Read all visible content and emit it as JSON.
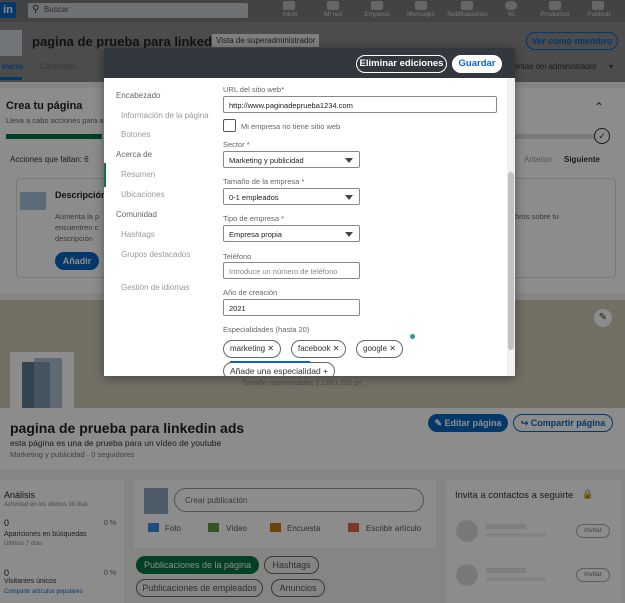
{
  "nav": {
    "logo": "in",
    "search_placeholder": "Buscar",
    "items": [
      "Inicio",
      "Mi red",
      "Empleos",
      "Mensajes",
      "Notificaciones",
      "Yo",
      "Productos",
      "Publicar"
    ]
  },
  "page": {
    "title": "pagina de prueba para linkedin ads",
    "admin_badge": "Vista de superadministrador",
    "view_as_member": "Ver como miembro",
    "tab_home": "Inicio",
    "tab_content": "Contenido",
    "admin_tools": "ientas del administrador",
    "create_title": "Crea tu página",
    "create_sub": "Lleva a cabo acciones para a",
    "actions_left": "Acciones que faltan: 6",
    "prev": "Anterior",
    "next": "Siguiente",
    "desc_title": "Descripción",
    "desc_lines": [
      "Aumenta la p",
      "encuentren c",
      "descripción"
    ],
    "right_text": "bros sobre tu",
    "add_btn": "Añadir",
    "banner_hint": "Tamaño recomendado: 1.128 x 191 px",
    "name": "pagina de prueba para linkedin ads",
    "tagline": "esta página es una de prueba para un vídeo de youtube",
    "meta": "Marketing y publicidad · 0 seguidores",
    "edit_page": "Editar página",
    "share_page": "Compartir página"
  },
  "analytics": {
    "title": "Análisis",
    "sub": "Actividad en los últimos 30 días",
    "v1": "0",
    "pct1": "0 %",
    "l1": "Apariciones en búsquedas",
    "l1sub": "Últimos 7 días",
    "v2": "0",
    "pct2": "0 %",
    "l2": "Visitantes únicos",
    "link": "Compartir artículos populares"
  },
  "post": {
    "placeholder": "Crear publicación",
    "photo": "Foto",
    "video": "Vídeo",
    "poll": "Encuesta",
    "article": "Escribir artículo"
  },
  "feedtabs": [
    "Publicaciones de la página",
    "Hashtags",
    "Publicaciones de empleados",
    "Anuncios"
  ],
  "invite": {
    "title": "Invita a contactos a seguirte",
    "btn": "Invitar"
  },
  "modal": {
    "discard": "Eliminar ediciones",
    "save": "Guardar",
    "sidenav": [
      {
        "label": "Encabezado",
        "sub": false
      },
      {
        "label": "Información de la página",
        "sub": true
      },
      {
        "label": "Botones",
        "sub": true
      },
      {
        "label": "Acerca de",
        "sub": false
      },
      {
        "label": "Resumen",
        "sub": true
      },
      {
        "label": "Ubicaciones",
        "sub": true
      },
      {
        "label": "Comunidad",
        "sub": false
      },
      {
        "label": "Hashtags",
        "sub": true
      },
      {
        "label": "Grupos destacados",
        "sub": true
      },
      {
        "label": "Gestión de idiomas",
        "sub": true
      }
    ],
    "url_label": "URL del sitio web*",
    "url_value": "http://www.paginadeprueba1234.com",
    "no_site": "Mi empresa no tiene sitio web",
    "sector_label": "Sector *",
    "sector_value": "Marketing y publicidad",
    "size_label": "Tamaño de la empresa *",
    "size_value": "0-1 empleados",
    "type_label": "Tipo de empresa *",
    "type_value": "Empresa propia",
    "phone_label": "Teléfono",
    "phone_placeholder": "Introduce un número de teléfono",
    "year_label": "Año de creación",
    "year_value": "2021",
    "spec_label": "Especialidades (hasta 20)",
    "chips": [
      "marketing",
      "facebook",
      "google"
    ],
    "add_spec": "Añade una especialidad"
  }
}
